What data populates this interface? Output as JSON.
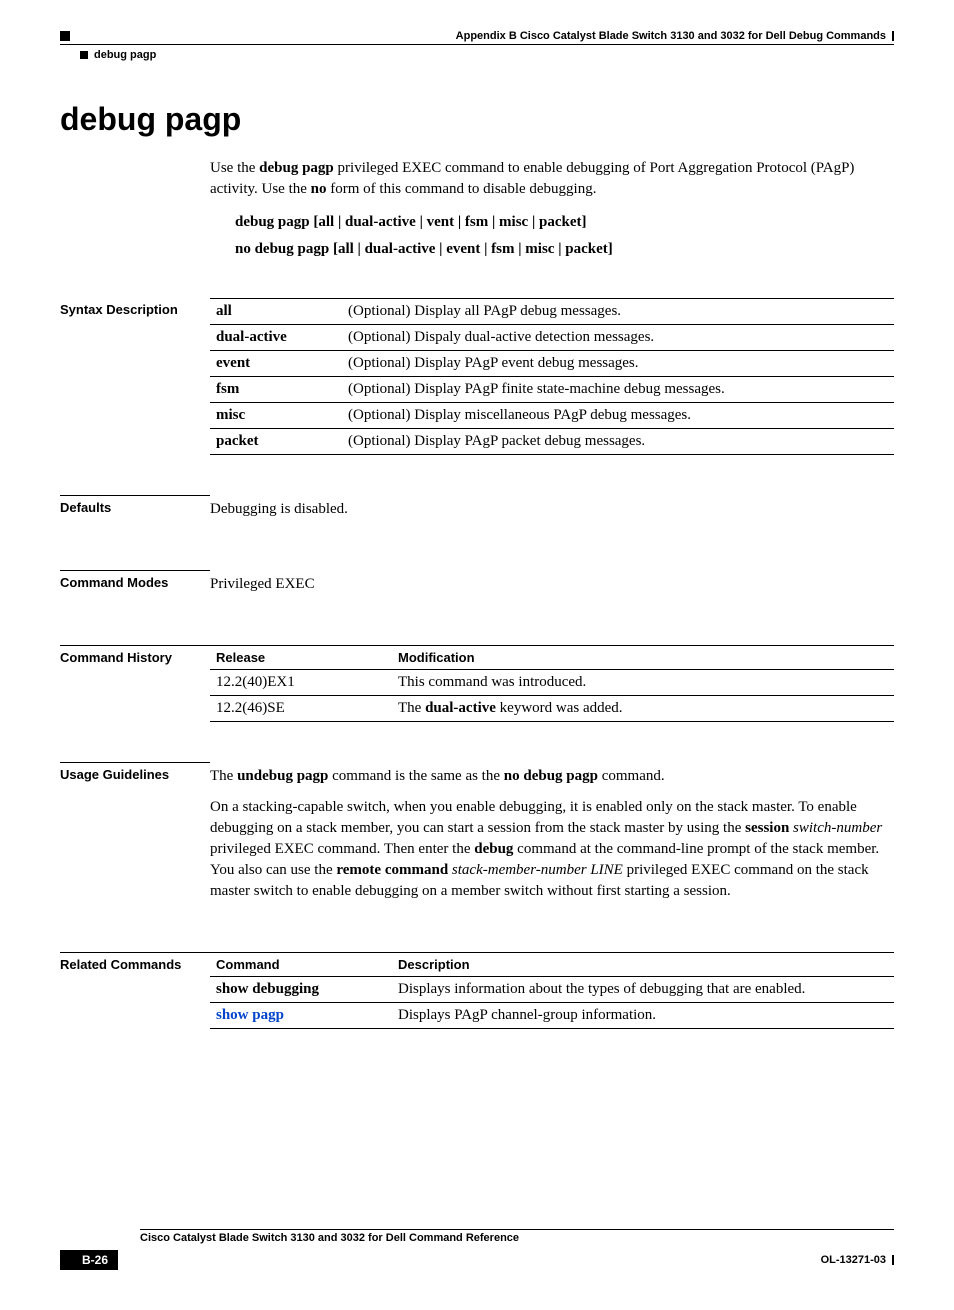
{
  "header": {
    "appendix": "Appendix B    Cisco Catalyst Blade Switch 3130 and 3032 for Dell Debug Commands",
    "section": "debug pagp"
  },
  "title": "debug pagp",
  "intro_parts": {
    "p1a": "Use the ",
    "cmd1": "debug pagp",
    "p1b": " privileged EXEC command to enable debugging of Port Aggregation Protocol (PAgP) activity. Use the ",
    "cmd2": "no",
    "p1c": " form of this command to disable debugging."
  },
  "syntax1": "debug pagp [all | dual-active | vent | fsm | misc | packet]",
  "syntax2": "no debug pagp [all | dual-active | event | fsm | misc | packet]",
  "sections": {
    "syntax_desc": {
      "label": "Syntax Description",
      "rows": [
        {
          "k": "all",
          "v": "(Optional) Display all PAgP debug messages."
        },
        {
          "k": "dual-active",
          "v": "(Optional) Dispaly dual-active detection messages."
        },
        {
          "k": "event",
          "v": "(Optional) Display PAgP event debug messages."
        },
        {
          "k": "fsm",
          "v": "(Optional) Display PAgP finite state-machine debug messages."
        },
        {
          "k": "misc",
          "v": "(Optional) Display miscellaneous PAgP debug messages."
        },
        {
          "k": "packet",
          "v": "(Optional) Display PAgP packet debug messages."
        }
      ]
    },
    "defaults": {
      "label": "Defaults",
      "text": "Debugging is disabled."
    },
    "modes": {
      "label": "Command Modes",
      "text": "Privileged EXEC"
    },
    "history": {
      "label": "Command History",
      "head": {
        "c1": "Release",
        "c2": "Modification"
      },
      "rows": [
        {
          "r": "12.2(40)EX1",
          "m": "This command was introduced."
        },
        {
          "r": "12.2(46)SE",
          "m_pre": "The ",
          "m_bold": "dual-active",
          "m_post": " keyword was added."
        }
      ]
    },
    "usage": {
      "label": "Usage Guidelines",
      "p1": {
        "a": "The ",
        "b": "undebug pagp",
        "c": " command is the same as the ",
        "d": "no debug pagp",
        "e": " command."
      },
      "p2": {
        "a": "On a stacking-capable switch, when you enable debugging, it is enabled only on the stack master. To enable debugging on a stack member, you can start a session from the stack master by using the ",
        "b": "session",
        "c": " ",
        "d": "switch-number",
        "e": " privileged EXEC command. Then enter the ",
        "f": "debug",
        "g": " command at the command-line prompt of the stack member. You also can use the ",
        "h": "remote command",
        "i": " ",
        "j": "stack-member-number LINE",
        "k": " privileged EXEC command on the stack master switch to enable debugging on a member switch without first starting a session."
      }
    },
    "related": {
      "label": "Related Commands",
      "head": {
        "c1": "Command",
        "c2": "Description"
      },
      "rows": [
        {
          "c": "show debugging",
          "d": "Displays information about the types of debugging that are enabled.",
          "link": false
        },
        {
          "c": "show pagp",
          "d": "Displays PAgP channel-group information.",
          "link": true
        }
      ]
    }
  },
  "footer": {
    "title": "Cisco Catalyst Blade Switch 3130 and 3032 for Dell Command Reference",
    "page": "B-26",
    "doc": "OL-13271-03"
  }
}
